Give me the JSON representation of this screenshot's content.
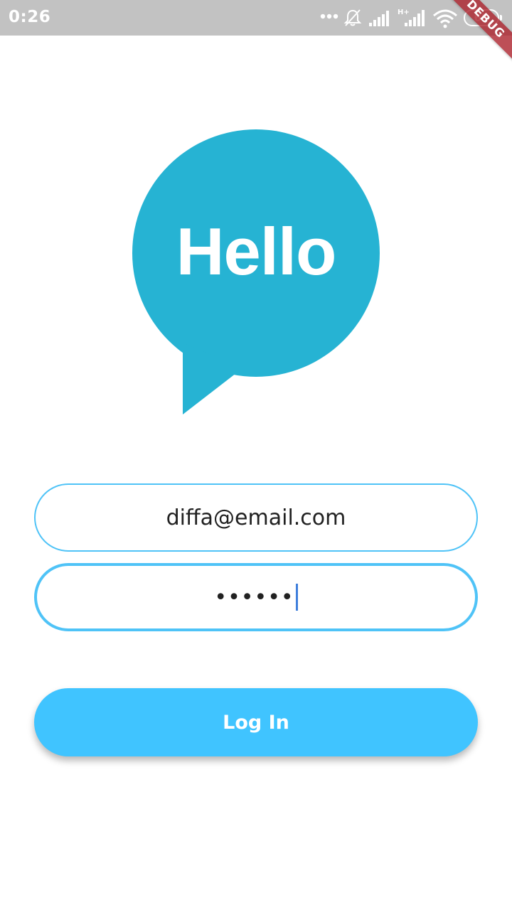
{
  "status_bar": {
    "time": "0:26",
    "battery": "68",
    "icons": [
      "more-dots-icon",
      "bell-muted-icon",
      "signal-icon",
      "signal-hplus-icon",
      "wifi-icon",
      "battery-icon"
    ]
  },
  "debug_banner": "DEBUG",
  "logo": {
    "text": "Hello",
    "color": "#26b3d3"
  },
  "form": {
    "email_value": "diffa@email.com",
    "password_masked": "••••••"
  },
  "login_button": {
    "label": "Log In",
    "color": "#40c4ff"
  },
  "colors": {
    "accent": "#4fc3f7",
    "status_bar": "#c2c2c2"
  }
}
